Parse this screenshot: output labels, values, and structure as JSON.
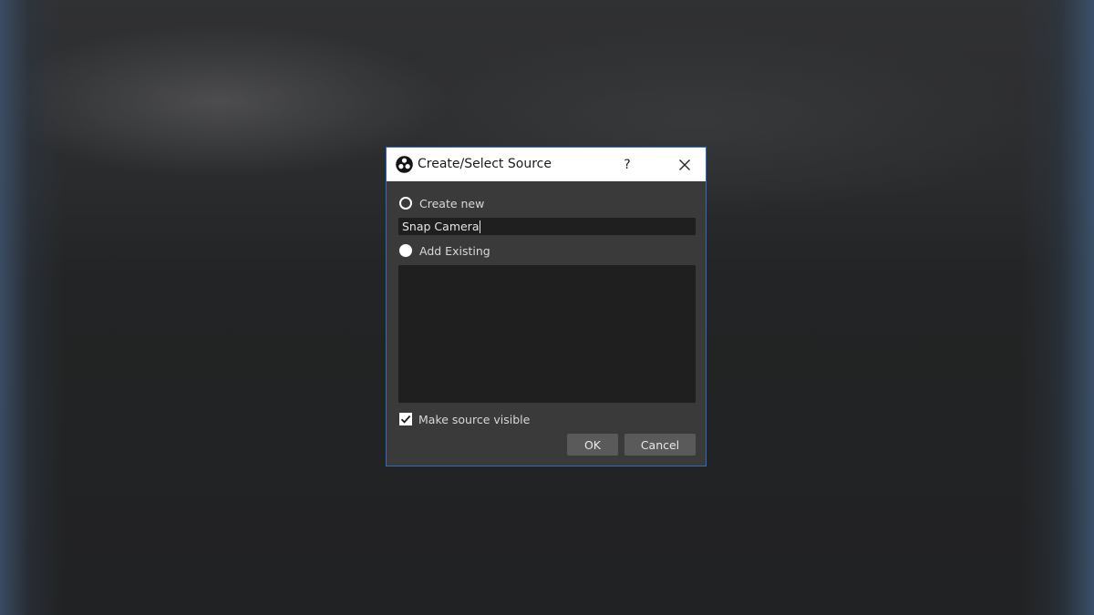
{
  "dialog": {
    "title": "Create/Select Source",
    "help_label": "?",
    "create_new_label": "Create new",
    "name_value": "Snap Camera",
    "add_existing_label": "Add Existing",
    "existing_sources": [],
    "make_visible_label": "Make source visible",
    "make_visible_checked": true,
    "selected_option": "create_new",
    "ok_label": "OK",
    "cancel_label": "Cancel"
  },
  "icons": {
    "app": "obs-logo-icon",
    "help": "help-icon",
    "close": "close-icon",
    "check": "checkmark-icon"
  },
  "colors": {
    "accent_border": "#2b6fb8",
    "dialog_bg": "#3a3a3a",
    "field_bg": "#1f1f1f",
    "button_bg": "#5a5a5a"
  }
}
